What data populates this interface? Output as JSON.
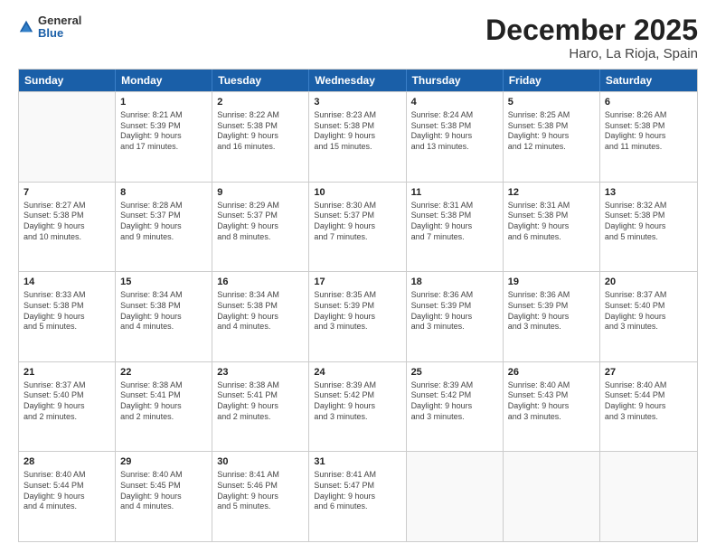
{
  "header": {
    "logo_general": "General",
    "logo_blue": "Blue",
    "month_title": "December 2025",
    "location": "Haro, La Rioja, Spain"
  },
  "weekdays": [
    "Sunday",
    "Monday",
    "Tuesday",
    "Wednesday",
    "Thursday",
    "Friday",
    "Saturday"
  ],
  "weeks": [
    [
      {
        "day": "",
        "lines": []
      },
      {
        "day": "1",
        "lines": [
          "Sunrise: 8:21 AM",
          "Sunset: 5:39 PM",
          "Daylight: 9 hours",
          "and 17 minutes."
        ]
      },
      {
        "day": "2",
        "lines": [
          "Sunrise: 8:22 AM",
          "Sunset: 5:38 PM",
          "Daylight: 9 hours",
          "and 16 minutes."
        ]
      },
      {
        "day": "3",
        "lines": [
          "Sunrise: 8:23 AM",
          "Sunset: 5:38 PM",
          "Daylight: 9 hours",
          "and 15 minutes."
        ]
      },
      {
        "day": "4",
        "lines": [
          "Sunrise: 8:24 AM",
          "Sunset: 5:38 PM",
          "Daylight: 9 hours",
          "and 13 minutes."
        ]
      },
      {
        "day": "5",
        "lines": [
          "Sunrise: 8:25 AM",
          "Sunset: 5:38 PM",
          "Daylight: 9 hours",
          "and 12 minutes."
        ]
      },
      {
        "day": "6",
        "lines": [
          "Sunrise: 8:26 AM",
          "Sunset: 5:38 PM",
          "Daylight: 9 hours",
          "and 11 minutes."
        ]
      }
    ],
    [
      {
        "day": "7",
        "lines": [
          "Sunrise: 8:27 AM",
          "Sunset: 5:38 PM",
          "Daylight: 9 hours",
          "and 10 minutes."
        ]
      },
      {
        "day": "8",
        "lines": [
          "Sunrise: 8:28 AM",
          "Sunset: 5:37 PM",
          "Daylight: 9 hours",
          "and 9 minutes."
        ]
      },
      {
        "day": "9",
        "lines": [
          "Sunrise: 8:29 AM",
          "Sunset: 5:37 PM",
          "Daylight: 9 hours",
          "and 8 minutes."
        ]
      },
      {
        "day": "10",
        "lines": [
          "Sunrise: 8:30 AM",
          "Sunset: 5:37 PM",
          "Daylight: 9 hours",
          "and 7 minutes."
        ]
      },
      {
        "day": "11",
        "lines": [
          "Sunrise: 8:31 AM",
          "Sunset: 5:38 PM",
          "Daylight: 9 hours",
          "and 7 minutes."
        ]
      },
      {
        "day": "12",
        "lines": [
          "Sunrise: 8:31 AM",
          "Sunset: 5:38 PM",
          "Daylight: 9 hours",
          "and 6 minutes."
        ]
      },
      {
        "day": "13",
        "lines": [
          "Sunrise: 8:32 AM",
          "Sunset: 5:38 PM",
          "Daylight: 9 hours",
          "and 5 minutes."
        ]
      }
    ],
    [
      {
        "day": "14",
        "lines": [
          "Sunrise: 8:33 AM",
          "Sunset: 5:38 PM",
          "Daylight: 9 hours",
          "and 5 minutes."
        ]
      },
      {
        "day": "15",
        "lines": [
          "Sunrise: 8:34 AM",
          "Sunset: 5:38 PM",
          "Daylight: 9 hours",
          "and 4 minutes."
        ]
      },
      {
        "day": "16",
        "lines": [
          "Sunrise: 8:34 AM",
          "Sunset: 5:38 PM",
          "Daylight: 9 hours",
          "and 4 minutes."
        ]
      },
      {
        "day": "17",
        "lines": [
          "Sunrise: 8:35 AM",
          "Sunset: 5:39 PM",
          "Daylight: 9 hours",
          "and 3 minutes."
        ]
      },
      {
        "day": "18",
        "lines": [
          "Sunrise: 8:36 AM",
          "Sunset: 5:39 PM",
          "Daylight: 9 hours",
          "and 3 minutes."
        ]
      },
      {
        "day": "19",
        "lines": [
          "Sunrise: 8:36 AM",
          "Sunset: 5:39 PM",
          "Daylight: 9 hours",
          "and 3 minutes."
        ]
      },
      {
        "day": "20",
        "lines": [
          "Sunrise: 8:37 AM",
          "Sunset: 5:40 PM",
          "Daylight: 9 hours",
          "and 3 minutes."
        ]
      }
    ],
    [
      {
        "day": "21",
        "lines": [
          "Sunrise: 8:37 AM",
          "Sunset: 5:40 PM",
          "Daylight: 9 hours",
          "and 2 minutes."
        ]
      },
      {
        "day": "22",
        "lines": [
          "Sunrise: 8:38 AM",
          "Sunset: 5:41 PM",
          "Daylight: 9 hours",
          "and 2 minutes."
        ]
      },
      {
        "day": "23",
        "lines": [
          "Sunrise: 8:38 AM",
          "Sunset: 5:41 PM",
          "Daylight: 9 hours",
          "and 2 minutes."
        ]
      },
      {
        "day": "24",
        "lines": [
          "Sunrise: 8:39 AM",
          "Sunset: 5:42 PM",
          "Daylight: 9 hours",
          "and 3 minutes."
        ]
      },
      {
        "day": "25",
        "lines": [
          "Sunrise: 8:39 AM",
          "Sunset: 5:42 PM",
          "Daylight: 9 hours",
          "and 3 minutes."
        ]
      },
      {
        "day": "26",
        "lines": [
          "Sunrise: 8:40 AM",
          "Sunset: 5:43 PM",
          "Daylight: 9 hours",
          "and 3 minutes."
        ]
      },
      {
        "day": "27",
        "lines": [
          "Sunrise: 8:40 AM",
          "Sunset: 5:44 PM",
          "Daylight: 9 hours",
          "and 3 minutes."
        ]
      }
    ],
    [
      {
        "day": "28",
        "lines": [
          "Sunrise: 8:40 AM",
          "Sunset: 5:44 PM",
          "Daylight: 9 hours",
          "and 4 minutes."
        ]
      },
      {
        "day": "29",
        "lines": [
          "Sunrise: 8:40 AM",
          "Sunset: 5:45 PM",
          "Daylight: 9 hours",
          "and 4 minutes."
        ]
      },
      {
        "day": "30",
        "lines": [
          "Sunrise: 8:41 AM",
          "Sunset: 5:46 PM",
          "Daylight: 9 hours",
          "and 5 minutes."
        ]
      },
      {
        "day": "31",
        "lines": [
          "Sunrise: 8:41 AM",
          "Sunset: 5:47 PM",
          "Daylight: 9 hours",
          "and 6 minutes."
        ]
      },
      {
        "day": "",
        "lines": []
      },
      {
        "day": "",
        "lines": []
      },
      {
        "day": "",
        "lines": []
      }
    ]
  ]
}
